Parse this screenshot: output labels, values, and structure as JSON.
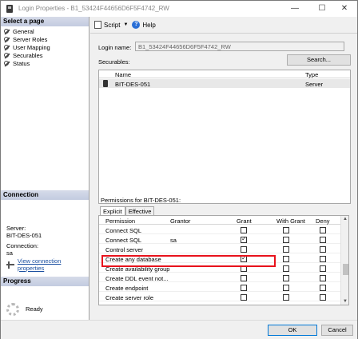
{
  "window": {
    "title": "Login Properties - B1_53424F44656D6F5F4742_RW",
    "minimize": "—",
    "maximize": "☐",
    "close": "✕"
  },
  "left": {
    "select_page_header": "Select a page",
    "nav": [
      "General",
      "Server Roles",
      "User Mapping",
      "Securables",
      "Status"
    ],
    "connection_header": "Connection",
    "server_label": "Server:",
    "server_value": "BIT-DES-051",
    "connection_label": "Connection:",
    "connection_value": "sa",
    "view_connection_link": "View connection properties",
    "progress_header": "Progress",
    "progress_status": "Ready"
  },
  "toolbar": {
    "script_label": "Script",
    "help_label": "Help"
  },
  "form": {
    "login_name_label": "Login name:",
    "login_name_value": "B1_53424F44656D6F5F4742_RW",
    "securables_label": "Securables:",
    "search_button": "Search..."
  },
  "securables_grid": {
    "columns": [
      "Name",
      "Type"
    ],
    "rows": [
      {
        "name": "BIT-DES-051",
        "type": "Server"
      }
    ]
  },
  "permissions": {
    "label": "Permissions for BIT-DES-051:",
    "tabs": [
      "Explicit",
      "Effective"
    ],
    "columns": [
      "Permission",
      "Grantor",
      "Grant",
      "With Grant",
      "Deny"
    ],
    "rows": [
      {
        "permission": "Connect SQL",
        "grantor": "",
        "grant": false,
        "with_grant": false,
        "deny": false
      },
      {
        "permission": "Connect SQL",
        "grantor": "sa",
        "grant": true,
        "with_grant": false,
        "deny": false
      },
      {
        "permission": "Control server",
        "grantor": "",
        "grant": false,
        "with_grant": false,
        "deny": false
      },
      {
        "permission": "Create any database",
        "grantor": "",
        "grant": true,
        "with_grant": false,
        "deny": false
      },
      {
        "permission": "Create availability group",
        "grantor": "",
        "grant": false,
        "with_grant": false,
        "deny": false
      },
      {
        "permission": "Create DDL event not...",
        "grantor": "",
        "grant": false,
        "with_grant": false,
        "deny": false
      },
      {
        "permission": "Create endpoint",
        "grantor": "",
        "grant": false,
        "with_grant": false,
        "deny": false
      },
      {
        "permission": "Create server role",
        "grantor": "",
        "grant": false,
        "with_grant": false,
        "deny": false
      }
    ]
  },
  "buttons": {
    "ok": "OK",
    "cancel": "Cancel"
  },
  "colors": {
    "highlight": "#e8121c",
    "link": "#1a4fa0"
  }
}
